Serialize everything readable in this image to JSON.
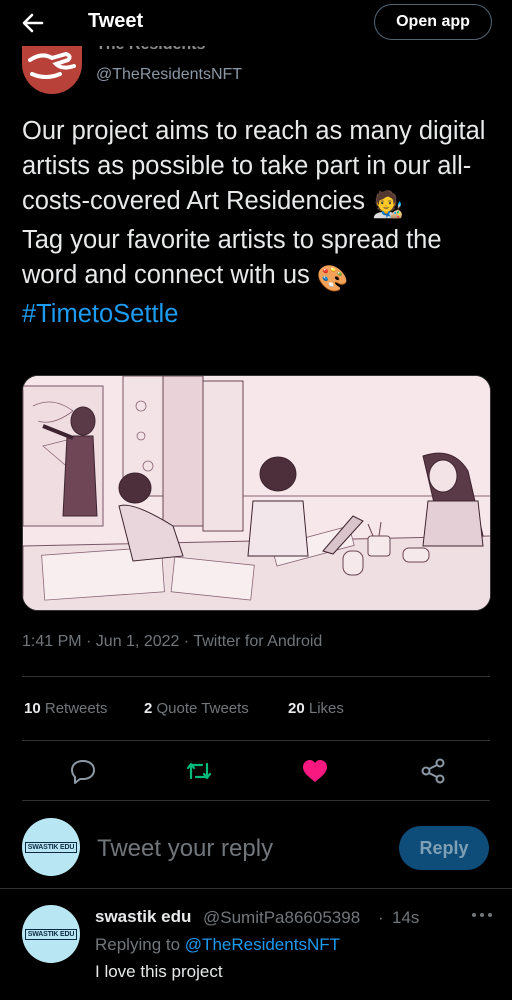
{
  "header": {
    "title": "Tweet",
    "open_app_label": "Open app"
  },
  "author": {
    "name": "The Residents",
    "handle": "@TheResidentsNFT"
  },
  "tweet": {
    "line1": "Our project aims to reach as many digital artists as possible to take part in our all-costs-covered Art Residencies",
    "emoji1": "🧑‍🎨",
    "line2": "Tag your favorite artists to spread the word and connect with us",
    "emoji2": "🎨",
    "hashtag": "#TimetoSettle",
    "timestamp": "1:41 PM · Jun 1, 2022 · Twitter for Android"
  },
  "stats": {
    "retweets_count": "10",
    "retweets_label": "Retweets",
    "quotes_count": "2",
    "quotes_label": "Quote Tweets",
    "likes_count": "20",
    "likes_label": "Likes"
  },
  "actions": {
    "reply_icon": "comment-icon",
    "retweet_icon": "retweet-icon",
    "like_icon": "heart-icon",
    "share_icon": "share-icon",
    "retweet_color": "#00ba7c",
    "like_color": "#f91880"
  },
  "composer": {
    "avatar_text": "SWASTIK EDU",
    "placeholder": "Tweet your reply",
    "reply_label": "Reply"
  },
  "reply": {
    "avatar_text": "SWASTIK EDU",
    "name": "swastik edu",
    "handle": "@SumitPa86605398",
    "separator": "·",
    "time": "14s",
    "replying_prefix": "Replying to",
    "replying_to": "@TheResidentsNFT",
    "text": "I love this project"
  },
  "colors": {
    "accent": "#1d9bf0",
    "background": "#000000"
  }
}
